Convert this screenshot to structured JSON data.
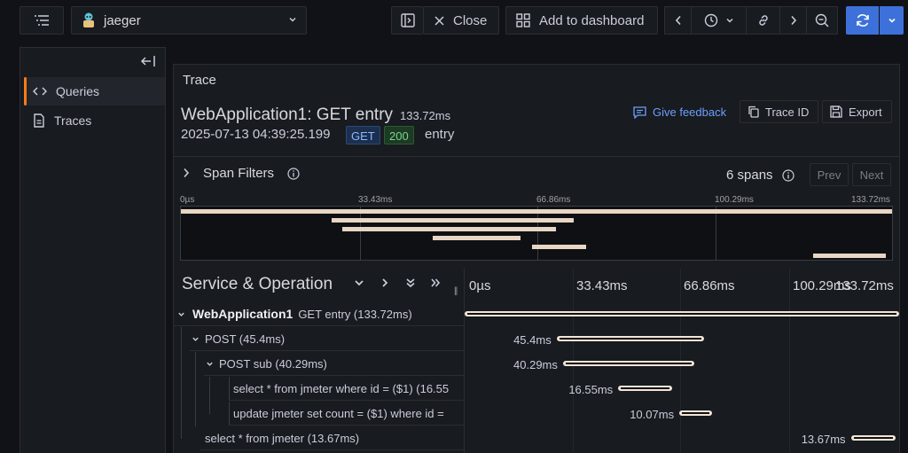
{
  "toolbar": {
    "datasource": "jaeger",
    "close_label": "Close",
    "add_dashboard_label": "Add to dashboard"
  },
  "sidebar": {
    "items": [
      {
        "label": "Queries"
      },
      {
        "label": "Traces"
      }
    ]
  },
  "trace": {
    "panel_title": "Trace",
    "name": "WebApplication1: GET entry",
    "duration": "133.72ms",
    "start": "2025-07-13 04:39:25.199",
    "method": "GET",
    "status": "200",
    "entry": "entry",
    "feedback_label": "Give feedback",
    "trace_id_label": "Trace ID",
    "export_label": "Export"
  },
  "filters": {
    "label": "Span Filters",
    "span_count": "6 spans",
    "prev_label": "Prev",
    "next_label": "Next"
  },
  "ticks": [
    "0µs",
    "33.43ms",
    "66.86ms",
    "100.29ms",
    "133.72ms"
  ],
  "timeline": {
    "column_title": "Service & Operation",
    "total_ms": 133.72
  },
  "spans": [
    {
      "service": "WebApplication1",
      "operation": "GET entry (133.72ms)",
      "duration": "",
      "start_ms": 0,
      "dur_ms": 133.72
    },
    {
      "service": "",
      "operation": "POST (45.4ms)",
      "duration": "45.4ms",
      "start_ms": 28.4,
      "dur_ms": 45.4
    },
    {
      "service": "",
      "operation": "POST sub (40.29ms)",
      "duration": "40.29ms",
      "start_ms": 30.3,
      "dur_ms": 40.29
    },
    {
      "service": "",
      "operation": "select * from jmeter where id = ($1) (16.55",
      "duration": "16.55ms",
      "start_ms": 47.3,
      "dur_ms": 16.55
    },
    {
      "service": "",
      "operation": "update jmeter set count = ($1) where id =",
      "duration": "10.07ms",
      "start_ms": 66.1,
      "dur_ms": 10.07
    },
    {
      "service": "",
      "operation": "select * from jmeter (13.67ms)",
      "duration": "13.67ms",
      "start_ms": 118.9,
      "dur_ms": 13.67
    }
  ]
}
